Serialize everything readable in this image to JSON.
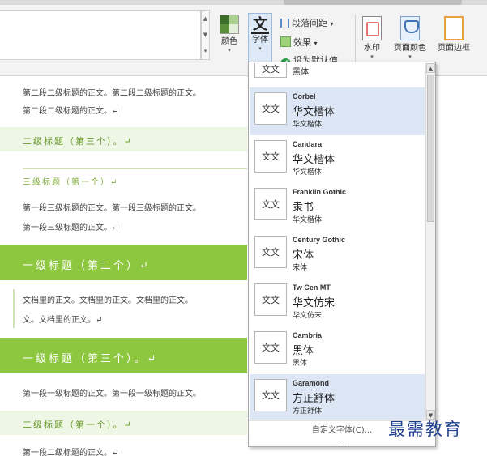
{
  "ribbon": {
    "color_label": "颜色",
    "font_label": "字体",
    "font_icon_glyph": "文",
    "para_spacing_label": "段落间距",
    "effect_label": "效果",
    "set_default_label": "设为默认值",
    "watermark_label": "水印",
    "page_color_label": "页面颜色",
    "page_border_label": "页面边框",
    "dropdown_arrow": "▾",
    "default_icon_glyph": "✔",
    "swatch_colors": [
      "#3c6e2a",
      "#a9d08e",
      "#5b8f3a",
      "#e2efd9"
    ]
  },
  "document": {
    "lines": [
      "第二段二级标题的正文。第二段二级标题的正文。",
      "第二段二级标题的正文。↵",
      "二级标题（第三个）。↵",
      "三级标题（第一个）↵",
      "第一段三级标题的正文。第一段三级标题的正文。",
      "第一段三级标题的正文。↵",
      "一级标题（第二个）↵",
      "文档里的正文。文档里的正文。文档里的正文。",
      "文。文档里的正文。↵",
      "一级标题（第三个）。↵",
      "第一段一级标题的正文。第一段一级标题的正文。",
      "二级标题（第一个）。↵",
      "第一段二级标题的正文。↵"
    ]
  },
  "font_panel": {
    "first_item": {
      "preview": "文文",
      "name": "黑体"
    },
    "items": [
      {
        "preview": "文文",
        "latin": "Corbel",
        "cn": "华文楷体",
        "small": "华文楷体",
        "highlighted": true
      },
      {
        "preview": "文文",
        "latin": "Candara",
        "cn": "华文楷体",
        "small": "华文楷体",
        "highlighted": false
      },
      {
        "preview": "文文",
        "latin": "Franklin Gothic",
        "cn": "隶书",
        "small": "华文楷体",
        "highlighted": false
      },
      {
        "preview": "文文",
        "latin": "Century Gothic",
        "cn": "宋体",
        "small": "宋体",
        "highlighted": false
      },
      {
        "preview": "文文",
        "latin": "Tw Cen MT",
        "cn": "华文仿宋",
        "small": "华文仿宋",
        "highlighted": false
      },
      {
        "preview": "文文",
        "latin": "Cambria",
        "cn": "黑体",
        "small": "黑体",
        "highlighted": false
      },
      {
        "preview": "文文",
        "latin": "Garamond",
        "cn": "方正舒体",
        "small": "方正舒体",
        "highlighted": true
      }
    ],
    "custom_label": "自定义字体(C)...",
    "scroll_up": "▲",
    "scroll_down": "▼",
    "grip": "....."
  },
  "gallery": {
    "up": "▲",
    "down": "▼",
    "more": "▾"
  },
  "logo": {
    "text": "最需教育"
  }
}
